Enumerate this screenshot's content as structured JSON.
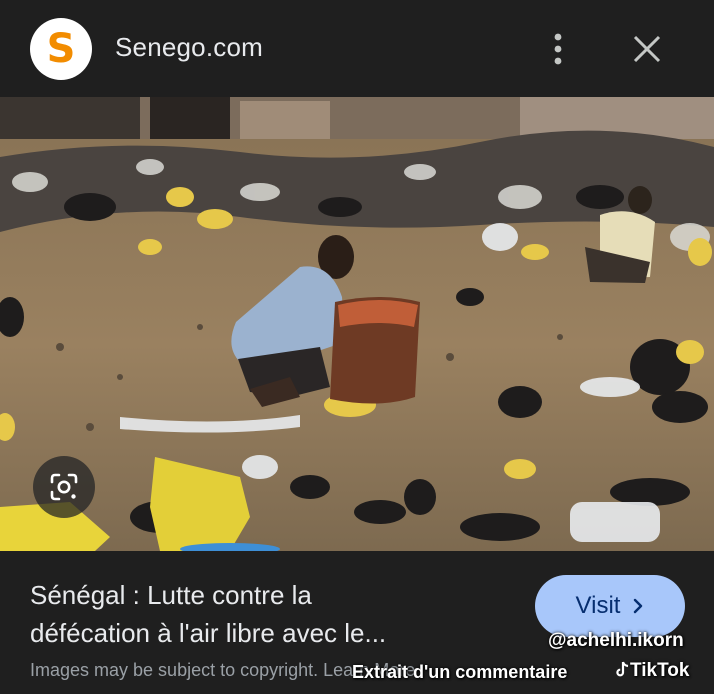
{
  "header": {
    "logo_letter": "S",
    "site_name": "Senego.com",
    "menu_icon": "more-vert-icon",
    "close_icon": "close-icon"
  },
  "image": {
    "lens_icon": "google-lens-icon"
  },
  "result": {
    "title_line1": "Sénégal : Lutte contre la",
    "title_line2": "défécation à l'air libre avec le...",
    "visit_label": "Visit",
    "visit_icon": "chevron-right-icon",
    "disclaimer": "Images may be subject to copyright.",
    "learn_more": "Learn More"
  },
  "watermark": {
    "handle": "@achelhi.ikorn",
    "extract": "Extrait d'un commentaire",
    "tiktok": "TikTok"
  },
  "colors": {
    "background": "#1f1f1f",
    "logo_accent": "#f28c00",
    "visit_button": "#a8c7fa",
    "visit_text": "#062e6f"
  }
}
